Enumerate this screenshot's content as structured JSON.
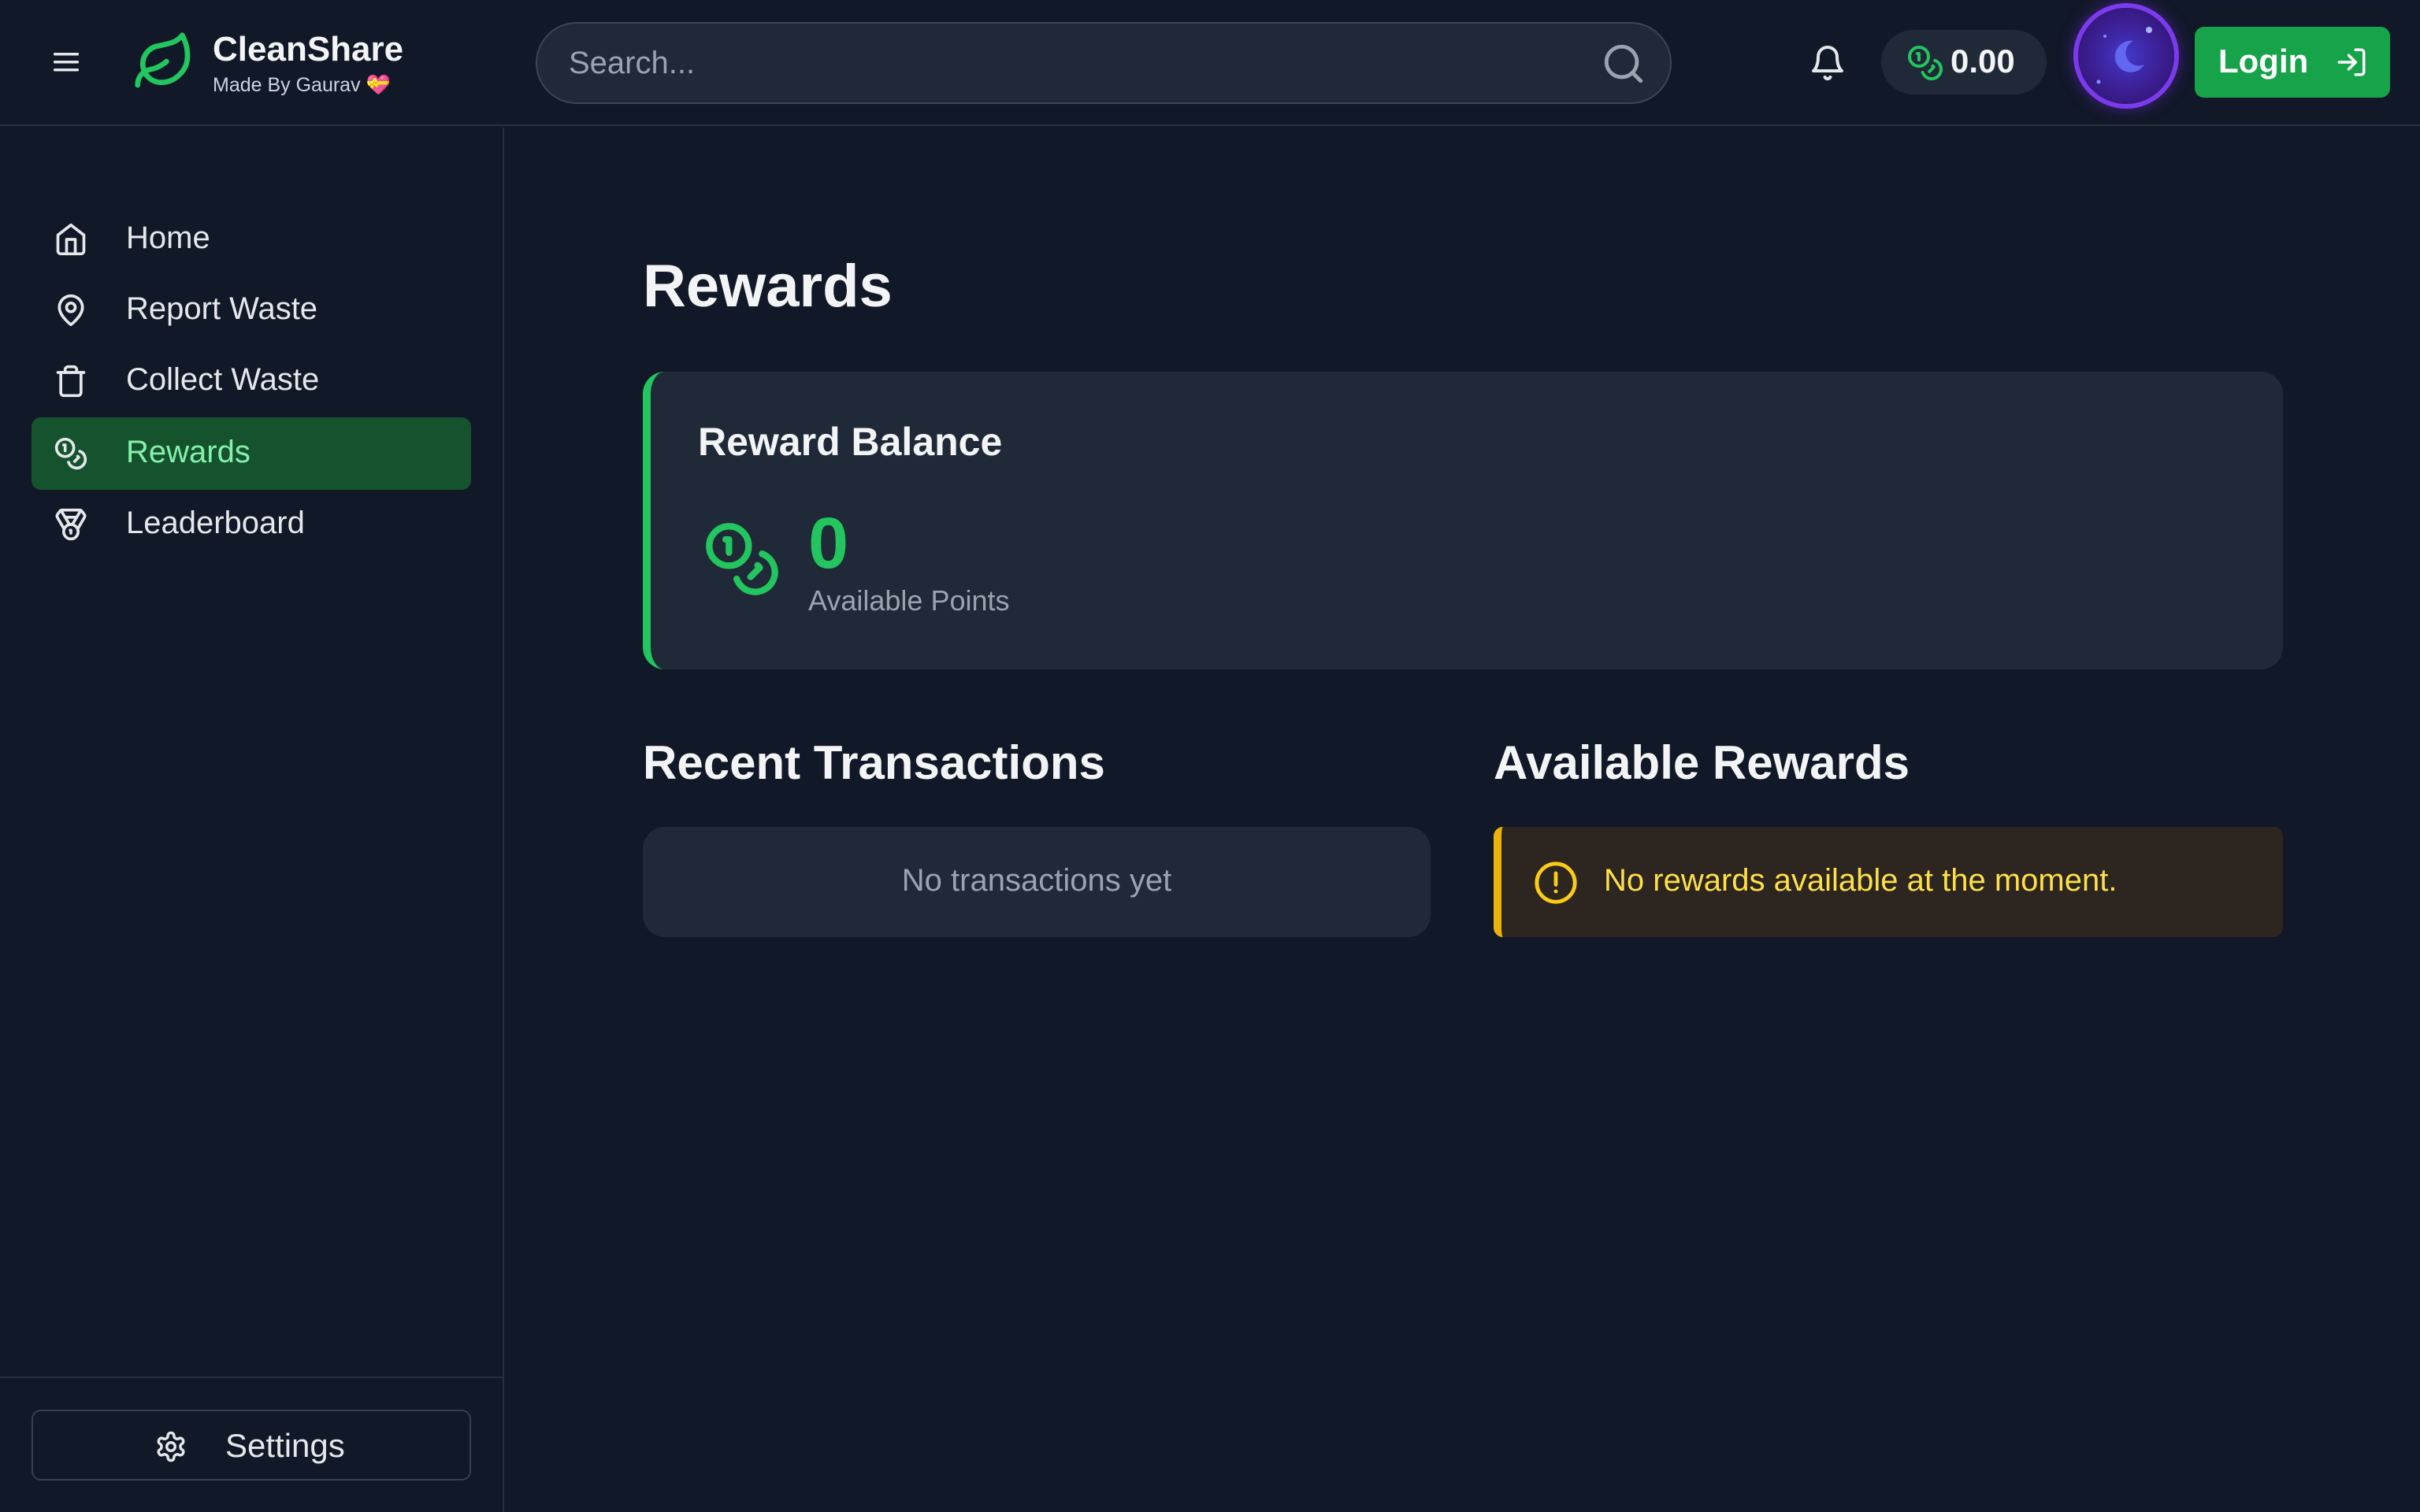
{
  "header": {
    "brand_name": "CleanShare",
    "brand_sub": "Made By Gaurav",
    "brand_sub_emoji": "💝",
    "search_placeholder": "Search...",
    "points_balance": "0.00",
    "login_label": "Login"
  },
  "sidebar": {
    "items": [
      {
        "label": "Home",
        "icon": "home-icon"
      },
      {
        "label": "Report Waste",
        "icon": "map-pin-icon"
      },
      {
        "label": "Collect Waste",
        "icon": "trash-icon"
      },
      {
        "label": "Rewards",
        "icon": "coins-icon",
        "active": true
      },
      {
        "label": "Leaderboard",
        "icon": "medal-icon"
      }
    ],
    "settings_label": "Settings"
  },
  "main": {
    "title": "Rewards",
    "balance_card": {
      "title": "Reward Balance",
      "points": "0",
      "points_label": "Available Points"
    },
    "transactions": {
      "title": "Recent Transactions",
      "empty_text": "No transactions yet"
    },
    "available_rewards": {
      "title": "Available Rewards",
      "alert_text": "No rewards available at the moment."
    }
  },
  "colors": {
    "background": "#111827",
    "card": "#1f2937",
    "accent_green": "#22c55e",
    "active_nav": "#14532d",
    "warning_yellow": "#eab308"
  }
}
